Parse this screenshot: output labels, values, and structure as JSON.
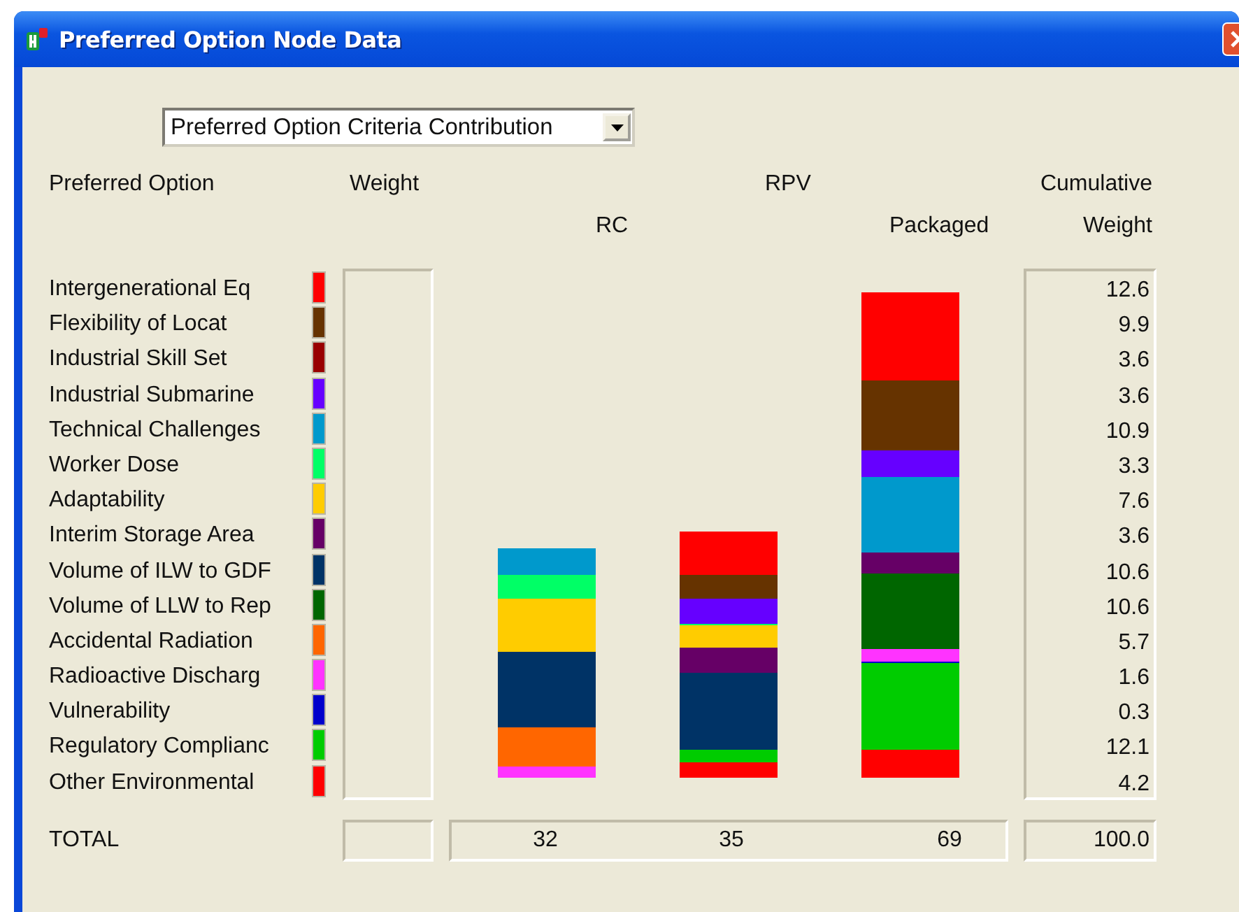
{
  "window": {
    "title": "Preferred Option Node Data"
  },
  "view_select": {
    "value": "Preferred Option Criteria Contribution"
  },
  "headers": {
    "preferred_option": "Preferred Option",
    "weight": "Weight",
    "rpv": "RPV",
    "cumulative": "Cumulative",
    "rc": "RC",
    "packaged": "Packaged",
    "cumulative_weight": "Weight"
  },
  "criteria": [
    {
      "name": "Intergenerational Eq",
      "color": "#ff0000",
      "cumulative_weight": "12.6"
    },
    {
      "name": "Flexibility of Locat",
      "color": "#663300",
      "cumulative_weight": "9.9"
    },
    {
      "name": "Industrial Skill Set",
      "color": "#990000",
      "cumulative_weight": "3.6"
    },
    {
      "name": "Industrial Submarine",
      "color": "#6600ff",
      "cumulative_weight": "3.6"
    },
    {
      "name": "Technical Challenges",
      "color": "#0099cc",
      "cumulative_weight": "10.9"
    },
    {
      "name": "Worker Dose",
      "color": "#00ff66",
      "cumulative_weight": "3.3"
    },
    {
      "name": "Adaptability",
      "color": "#ffcc00",
      "cumulative_weight": "7.6"
    },
    {
      "name": "Interim Storage Area",
      "color": "#660066",
      "cumulative_weight": "3.6"
    },
    {
      "name": "Volume of ILW to GDF",
      "color": "#003366",
      "cumulative_weight": "10.6"
    },
    {
      "name": "Volume of LLW to Rep",
      "color": "#006600",
      "cumulative_weight": "10.6"
    },
    {
      "name": "Accidental Radiation",
      "color": "#ff6600",
      "cumulative_weight": "5.7"
    },
    {
      "name": "Radioactive Discharg",
      "color": "#ff33ff",
      "cumulative_weight": "1.6"
    },
    {
      "name": "Vulnerability",
      "color": "#0000cc",
      "cumulative_weight": "0.3"
    },
    {
      "name": "Regulatory Complianc",
      "color": "#00cc00",
      "cumulative_weight": "12.1"
    },
    {
      "name": "Other Environmental",
      "color": "#ff0000",
      "cumulative_weight": "4.2"
    }
  ],
  "total": {
    "label": "TOTAL",
    "rc": "32",
    "rpv": "35",
    "packaged": "69",
    "cumulative_weight": "100.0"
  }
}
